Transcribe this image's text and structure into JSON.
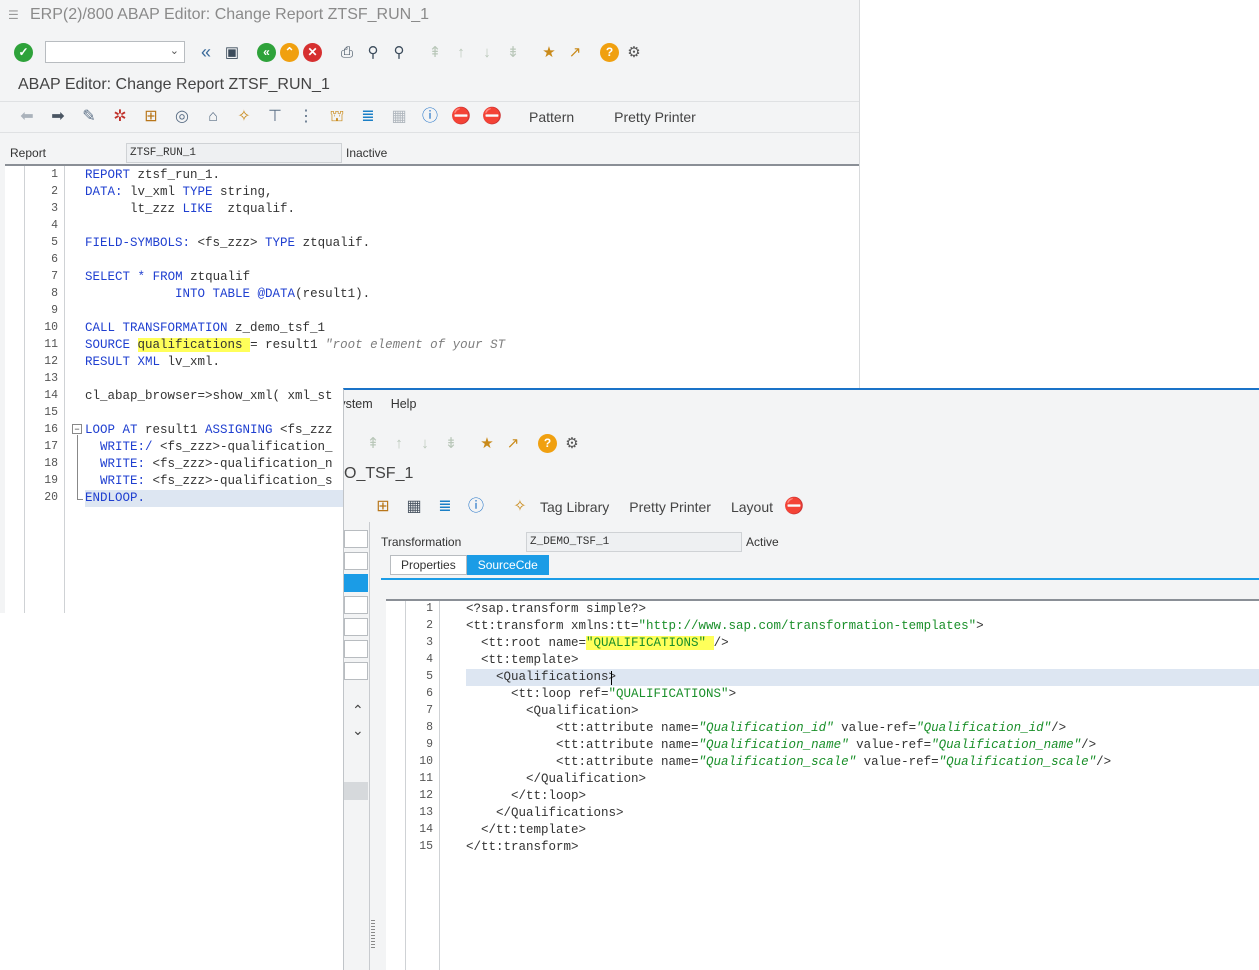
{
  "window1": {
    "title": "ERP(2)/800 ABAP Editor: Change Report ZTSF_RUN_1",
    "screen_title": "ABAP Editor: Change Report ZTSF_RUN_1",
    "app_toolbar": {
      "pattern_label": "Pattern",
      "pretty_printer_label": "Pretty Printer"
    },
    "report_field": {
      "label": "Report",
      "value": "ZTSF_RUN_1",
      "status": "Inactive"
    },
    "line_numbers": [
      "1",
      "2",
      "3",
      "4",
      "5",
      "6",
      "7",
      "8",
      "9",
      "10",
      "11",
      "12",
      "13",
      "14",
      "15",
      "16",
      "17",
      "18",
      "19",
      "20"
    ]
  },
  "window2": {
    "menu": {
      "system": "System",
      "help": "Help"
    },
    "screen_title_partial": "O_TSF_1",
    "app_toolbar": {
      "tag_library": "Tag Library",
      "pretty_printer": "Pretty Printer",
      "layout": "Layout"
    },
    "transformation_field": {
      "label": "Transformation",
      "value": "Z_DEMO_TSF_1",
      "status": "Active"
    },
    "tabs": {
      "properties": "Properties",
      "sourcecode": "SourceCde"
    },
    "line_numbers": [
      "1",
      "2",
      "3",
      "4",
      "5",
      "6",
      "7",
      "8",
      "9",
      "10",
      "11",
      "12",
      "13",
      "14",
      "15"
    ]
  },
  "icons": [
    "enter-check-icon",
    "back-icon",
    "save-icon",
    "exit-icon",
    "cancel-icon",
    "print-icon",
    "find-icon",
    "help-icon",
    "settings-icon"
  ]
}
